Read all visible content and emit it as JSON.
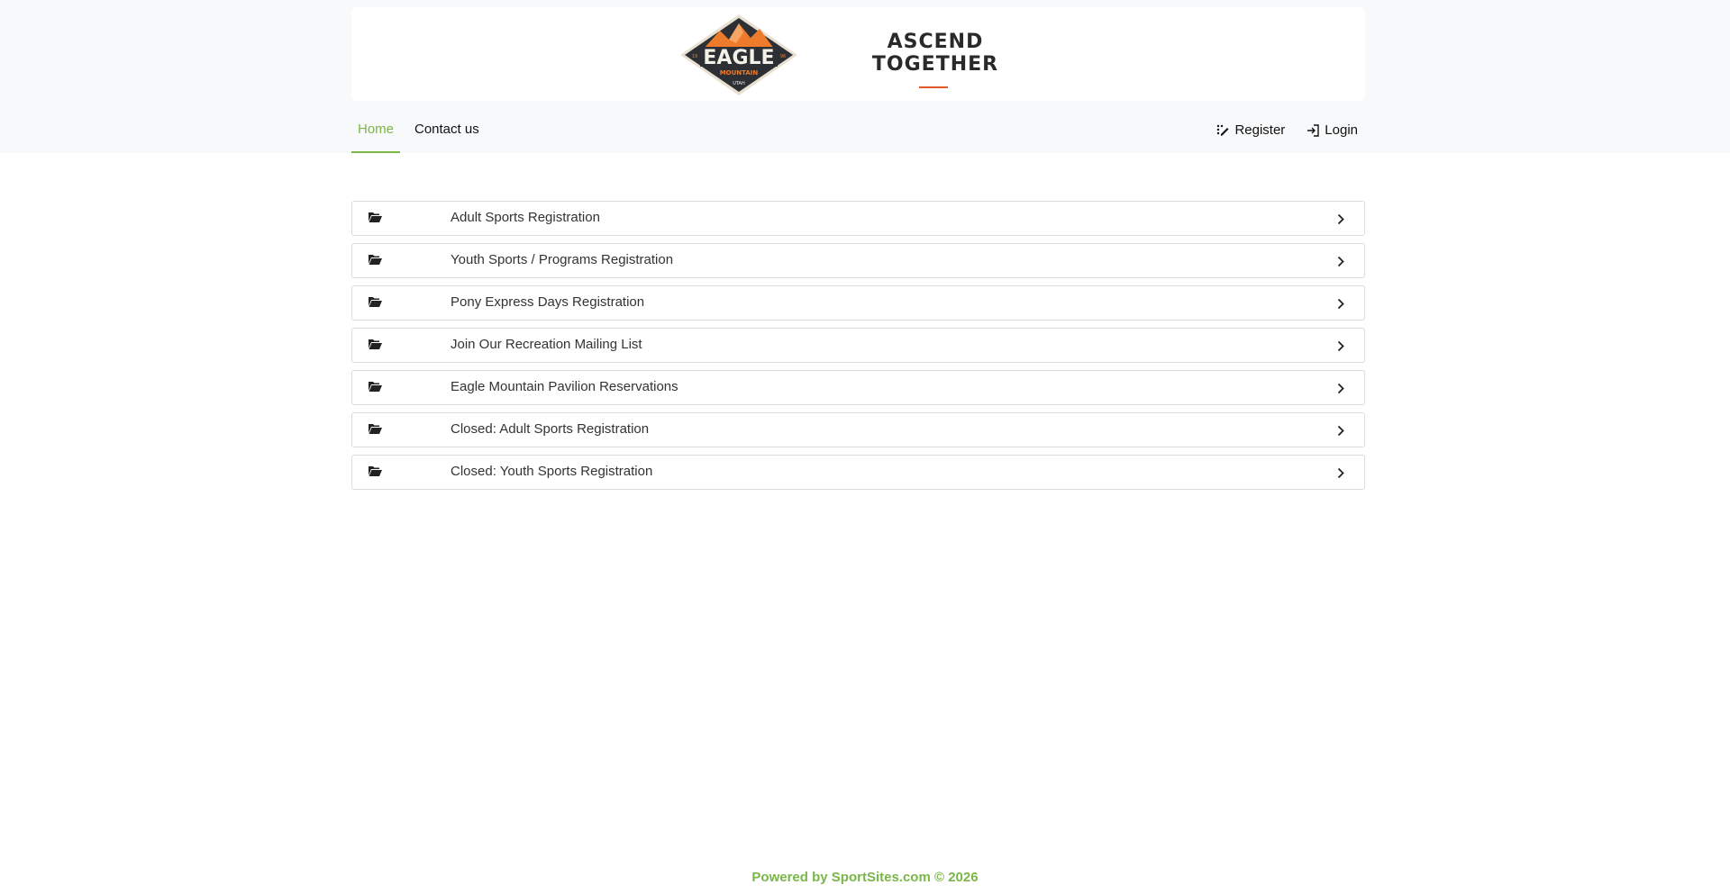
{
  "header": {
    "logo": {
      "name": "EAGLE",
      "sub": "MOUNTAIN",
      "state": "UTAH",
      "year_left": "19",
      "year_right": "96"
    },
    "slogan": "ASCEND TOGETHER"
  },
  "nav": {
    "home": "Home",
    "contact": "Contact us",
    "register": "Register",
    "login": "Login"
  },
  "registrations": [
    {
      "label": "Adult Sports Registration",
      "icon": "folder-open-icon"
    },
    {
      "label": "Youth Sports / Programs Registration",
      "icon": "folder-open-icon"
    },
    {
      "label": "Pony Express Days Registration",
      "icon": "folder-open-icon"
    },
    {
      "label": "Join Our Recreation Mailing List",
      "icon": "folder-open-icon"
    },
    {
      "label": "Eagle Mountain Pavilion Reservations",
      "icon": "folder-open-icon"
    },
    {
      "label": "Closed: Adult Sports Registration",
      "icon": "folder-open-icon"
    },
    {
      "label": "Closed: Youth Sports Registration",
      "icon": "folder-open-icon"
    }
  ],
  "footer": {
    "text": "Powered by SportSites.com © 2026"
  },
  "colors": {
    "accent_green": "#7ab648",
    "accent_orange": "#e0572a",
    "logo_dark": "#2c2f33",
    "band_bg": "#f8f9fa"
  }
}
